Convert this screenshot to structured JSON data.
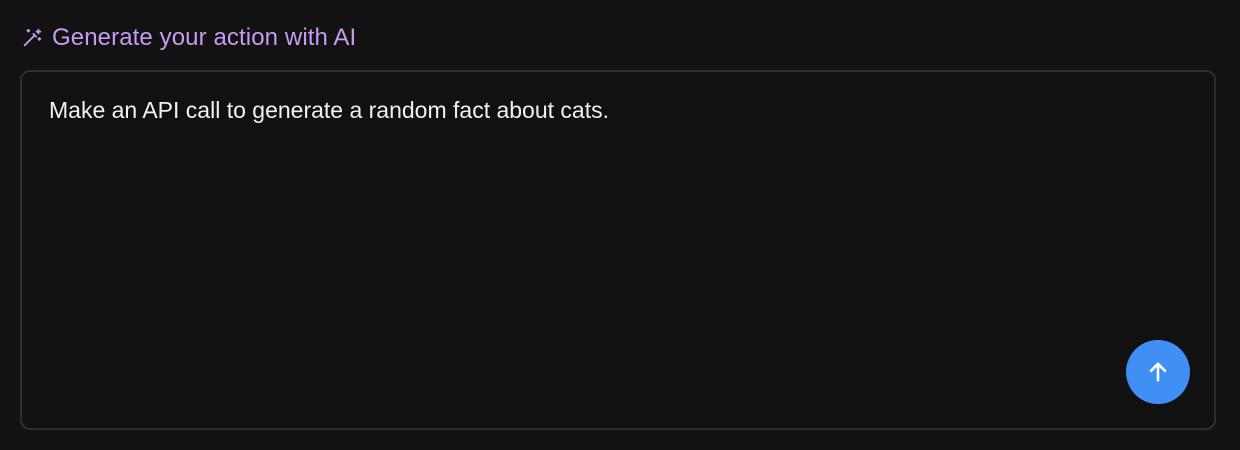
{
  "header": {
    "icon": "magic-wand-icon",
    "title": "Generate your action with AI"
  },
  "prompt": {
    "value": "Make an API call to generate a random fact about cats."
  },
  "send_button": {
    "icon": "arrow-up-icon"
  },
  "colors": {
    "accent": "#c79bf2",
    "send_button": "#3f8ff5",
    "background": "#121212",
    "panel_border": "#2e2e30",
    "text": "#f1f1f1"
  }
}
